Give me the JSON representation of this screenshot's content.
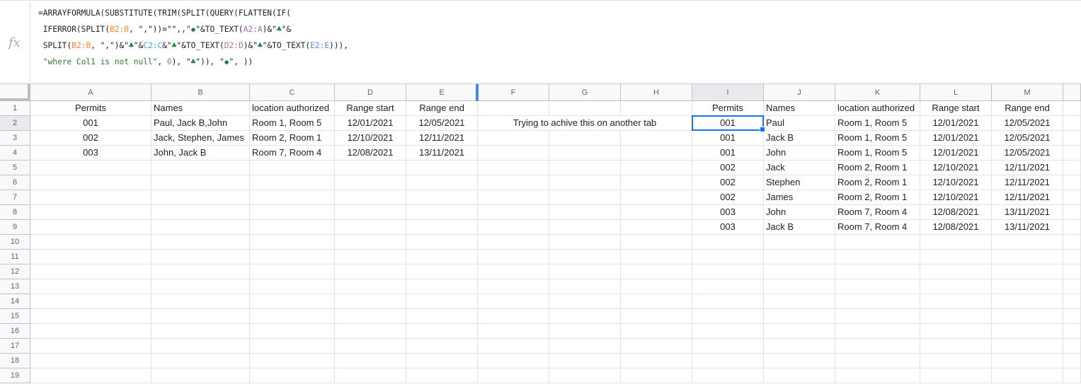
{
  "formula_bar": {
    "icon": "fx-icon",
    "icon_glyph": "fx",
    "lines": [
      [
        {
          "t": "=ARRAYFORMULA(SUBSTITUTE(TRIM(SPLIT(QUERY(FLATTEN(IF(",
          "k": ""
        }
      ],
      [
        {
          "t": " IFERROR(SPLIT(",
          "k": ""
        },
        {
          "t": "B2:B",
          "k": "r-b"
        },
        {
          "t": ", \",\"))=\"\",,\"",
          "k": ""
        },
        {
          "t": "◆",
          "k": "sym"
        },
        {
          "t": "\"&TO_TEXT(",
          "k": ""
        },
        {
          "t": "A2:A",
          "k": "r-a"
        },
        {
          "t": ")&\"",
          "k": ""
        },
        {
          "t": "♣",
          "k": "sym"
        },
        {
          "t": "\"&",
          "k": ""
        }
      ],
      [
        {
          "t": " SPLIT(",
          "k": ""
        },
        {
          "t": "B2:B",
          "k": "r-b"
        },
        {
          "t": ", \",\")&\"",
          "k": ""
        },
        {
          "t": "♣",
          "k": "sym"
        },
        {
          "t": "\"&",
          "k": ""
        },
        {
          "t": "C2:C",
          "k": "r-c"
        },
        {
          "t": "&\"",
          "k": ""
        },
        {
          "t": "♣",
          "k": "sym"
        },
        {
          "t": "\"&TO_TEXT(",
          "k": ""
        },
        {
          "t": "D2:D",
          "k": "r-d"
        },
        {
          "t": ")&\"",
          "k": ""
        },
        {
          "t": "♣",
          "k": "sym"
        },
        {
          "t": "\"&TO_TEXT(",
          "k": ""
        },
        {
          "t": "E2:E",
          "k": "r-e"
        },
        {
          "t": "))),",
          "k": ""
        }
      ],
      [
        {
          "t": " ",
          "k": ""
        },
        {
          "t": "\"where Col1 is not null\"",
          "k": "str"
        },
        {
          "t": ", ",
          "k": ""
        },
        {
          "t": "0",
          "k": "num"
        },
        {
          "t": "), \"",
          "k": ""
        },
        {
          "t": "♣",
          "k": "sym"
        },
        {
          "t": "\")), \"",
          "k": ""
        },
        {
          "t": "◆",
          "k": "sym"
        },
        {
          "t": "\", ))",
          "k": ""
        }
      ]
    ]
  },
  "columns": [
    "A",
    "B",
    "C",
    "D",
    "E",
    "F",
    "G",
    "H",
    "I",
    "J",
    "K",
    "L",
    "M",
    ""
  ],
  "selected_column": "I",
  "selected_row": "2",
  "active_cell": "I2",
  "row_numbers": [
    "1",
    "2",
    "3",
    "4",
    "5",
    "6",
    "7",
    "8",
    "9",
    "10",
    "11",
    "12",
    "13",
    "14",
    "15",
    "16",
    "17",
    "18",
    "19"
  ],
  "source_table": {
    "headers": [
      "Permits",
      "Names",
      "location authorized",
      "Range start",
      "Range end"
    ],
    "rows": [
      [
        "001",
        "Paul, Jack B,John",
        "Room 1, Room 5",
        "12/01/2021",
        "12/05/2021"
      ],
      [
        "002",
        "Jack, Stephen, James",
        "Room 2, Room 1",
        "12/10/2021",
        "12/11/2021"
      ],
      [
        "003",
        "John, Jack B",
        "Room 7, Room 4",
        "12/08/2021",
        "13/11/2021"
      ]
    ]
  },
  "note": "Trying to achive this on another tab",
  "result_table": {
    "headers": [
      "Permits",
      "Names",
      "location authorized",
      "Range start",
      "Range end"
    ],
    "rows": [
      [
        "001",
        "Paul",
        "Room 1, Room 5",
        "12/01/2021",
        "12/05/2021"
      ],
      [
        "001",
        "Jack B",
        "Room 1, Room 5",
        "12/01/2021",
        "12/05/2021"
      ],
      [
        "001",
        "John",
        "Room 1, Room 5",
        "12/01/2021",
        "12/05/2021"
      ],
      [
        "002",
        "Jack",
        "Room 2, Room 1",
        "12/10/2021",
        "12/11/2021"
      ],
      [
        "002",
        "Stephen",
        "Room 2, Room 1",
        "12/10/2021",
        "12/11/2021"
      ],
      [
        "002",
        "James",
        "Room 2, Room 1",
        "12/10/2021",
        "12/11/2021"
      ],
      [
        "003",
        "John",
        "Room 7, Room 4",
        "12/08/2021",
        "13/11/2021"
      ],
      [
        "003",
        "Jack B",
        "Room 7, Room 4",
        "12/08/2021",
        "13/11/2021"
      ]
    ]
  },
  "colors": {
    "selection": "#1a73e8",
    "freeze_marker": "#4a86e8",
    "header_bg": "#f8f9fa"
  }
}
